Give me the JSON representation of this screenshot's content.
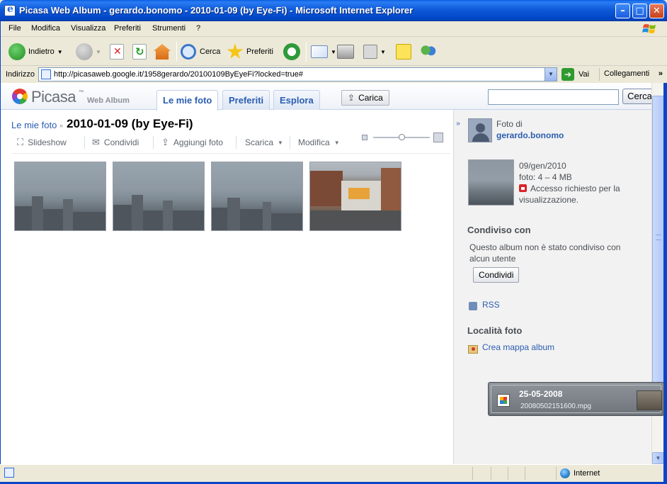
{
  "window": {
    "title": "Picasa Web Album - gerardo.bonomo - 2010-01-09 (by Eye-Fi) - Microsoft Internet Explorer",
    "controls": [
      "minimize-icon",
      "maximize-icon",
      "close-icon"
    ]
  },
  "menu": {
    "items": [
      "File",
      "Modifica",
      "Visualizza",
      "Preferiti",
      "Strumenti",
      "?"
    ]
  },
  "toolbar": {
    "back": "Indietro",
    "search": "Cerca",
    "favorites": "Preferiti"
  },
  "address": {
    "label": "Indirizzo",
    "url": "http://picasaweb.google.it/1958gerardo/20100109ByEyeFi?locked=true#",
    "go": "Vai",
    "links": "Collegamenti"
  },
  "picasa": {
    "logo": "Picasa",
    "logo_tm": "™",
    "logo_sub": "Web Album",
    "tabs": [
      "Le mie foto",
      "Preferiti",
      "Esplora"
    ],
    "upload": "Carica",
    "search_value": "",
    "search_button": "Cerca"
  },
  "album": {
    "breadcrumb": "Le mie foto",
    "breadcrumb_sep": "»",
    "title": "2010-01-09 (by Eye-Fi)",
    "actions": {
      "slideshow": "Slideshow",
      "share": "Condividi",
      "add": "Aggiungi foto",
      "download": "Scarica",
      "edit": "Modifica"
    },
    "photos": [
      {
        "kind": "foggy-skyline"
      },
      {
        "kind": "foggy-skyline"
      },
      {
        "kind": "foggy-skyline"
      },
      {
        "kind": "city-square"
      }
    ],
    "zoom_level": 0.5
  },
  "sidebar": {
    "photo_by": "Foto di",
    "owner": "gerardo.bonomo",
    "date": "09/gen/2010",
    "size": "foto: 4 – 4 MB",
    "access": "Accesso richiesto per la",
    "access2": "visualizzazione.",
    "shared_heading": "Condiviso con",
    "shared_text": "Questo album non è stato condiviso con",
    "shared_text2": "alcun utente",
    "share_button": "Condividi",
    "rss": "RSS",
    "location_heading": "Località foto",
    "map_link": "Crea mappa album"
  },
  "eyefi": {
    "date": "25-05-2008",
    "file": "20080502151600.mpg"
  },
  "status": {
    "zone": "Internet"
  }
}
